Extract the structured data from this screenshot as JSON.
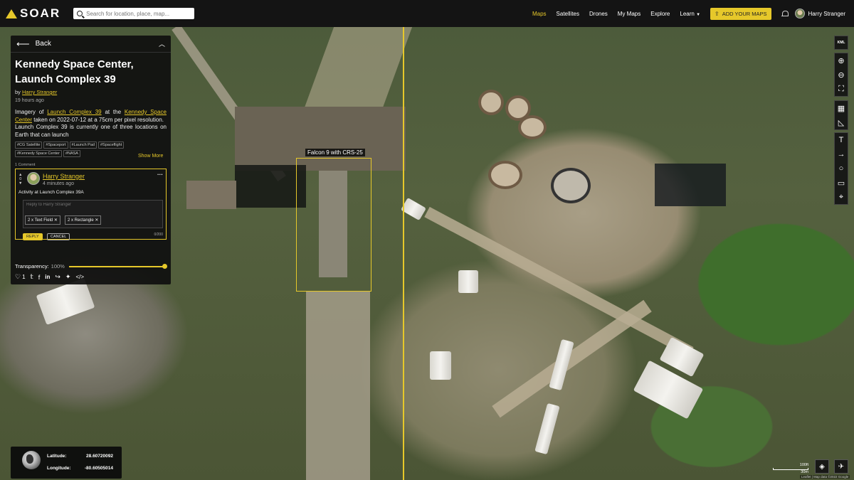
{
  "nav": {
    "logo_text": "SOAR",
    "search_placeholder": "Search for location, place, map...",
    "items": [
      "Maps",
      "Satellites",
      "Drones",
      "My Maps",
      "Explore",
      "Learn"
    ],
    "active_item": "Maps",
    "add_button_label": "ADD YOUR MAPS",
    "user_name": "Harry Stranger",
    "accent_color": "#e6c82a"
  },
  "panel": {
    "back_label": "Back",
    "title": "Kennedy Space Center, Launch Complex 39",
    "by_prefix": "by",
    "author": "Harry Stranger",
    "time_ago": "19 hours ago",
    "desc": {
      "p1_a": "Imagery of",
      "p1_link1": "Launch Complex 39",
      "p1_b": "at the",
      "p1_link2": "Kennedy Space Center",
      "p1_c": "taken on 2022-07-12 at a 75cm per pixel resolution.",
      "p2": "Launch Complex 39 is currently one of three locations on Earth that can launch"
    },
    "tags": [
      "#CG Satellite",
      "#Spaceport",
      "#Launch Pad",
      "#Spaceflight",
      "#Kennedy Space Center",
      "#NASA"
    ],
    "show_more": "Show More",
    "comment_count": "1 Comment",
    "comment": {
      "vote_count": "0",
      "author": "Harry Stranger",
      "time_ago": "4 minutes ago",
      "text": "Activity at Launch Complex 39A",
      "reply_placeholder": "Reply to Harry Stranger",
      "chips": [
        "2 x Text Field",
        "2 x Rectangle"
      ],
      "reply_label": "REPLY",
      "cancel_label": "CANCEL",
      "char_count": "0/200"
    },
    "transparency_label": "Transparency:",
    "transparency_value": "100%",
    "transparency_fraction": 1.0,
    "like_count": "1"
  },
  "annotation": {
    "label": "Falcon 9 with CRS-25"
  },
  "toolbar": {
    "kml_label": "KML"
  },
  "coords": {
    "lat_label": "Latitude:",
    "lat_value": "28.60720092",
    "lng_label": "Longitude:",
    "lng_value": "-80.60505014"
  },
  "scale": {
    "imperial": "100ft",
    "metric": "30m"
  },
  "attribution": "Leaflet | Map data ©2022 Google"
}
